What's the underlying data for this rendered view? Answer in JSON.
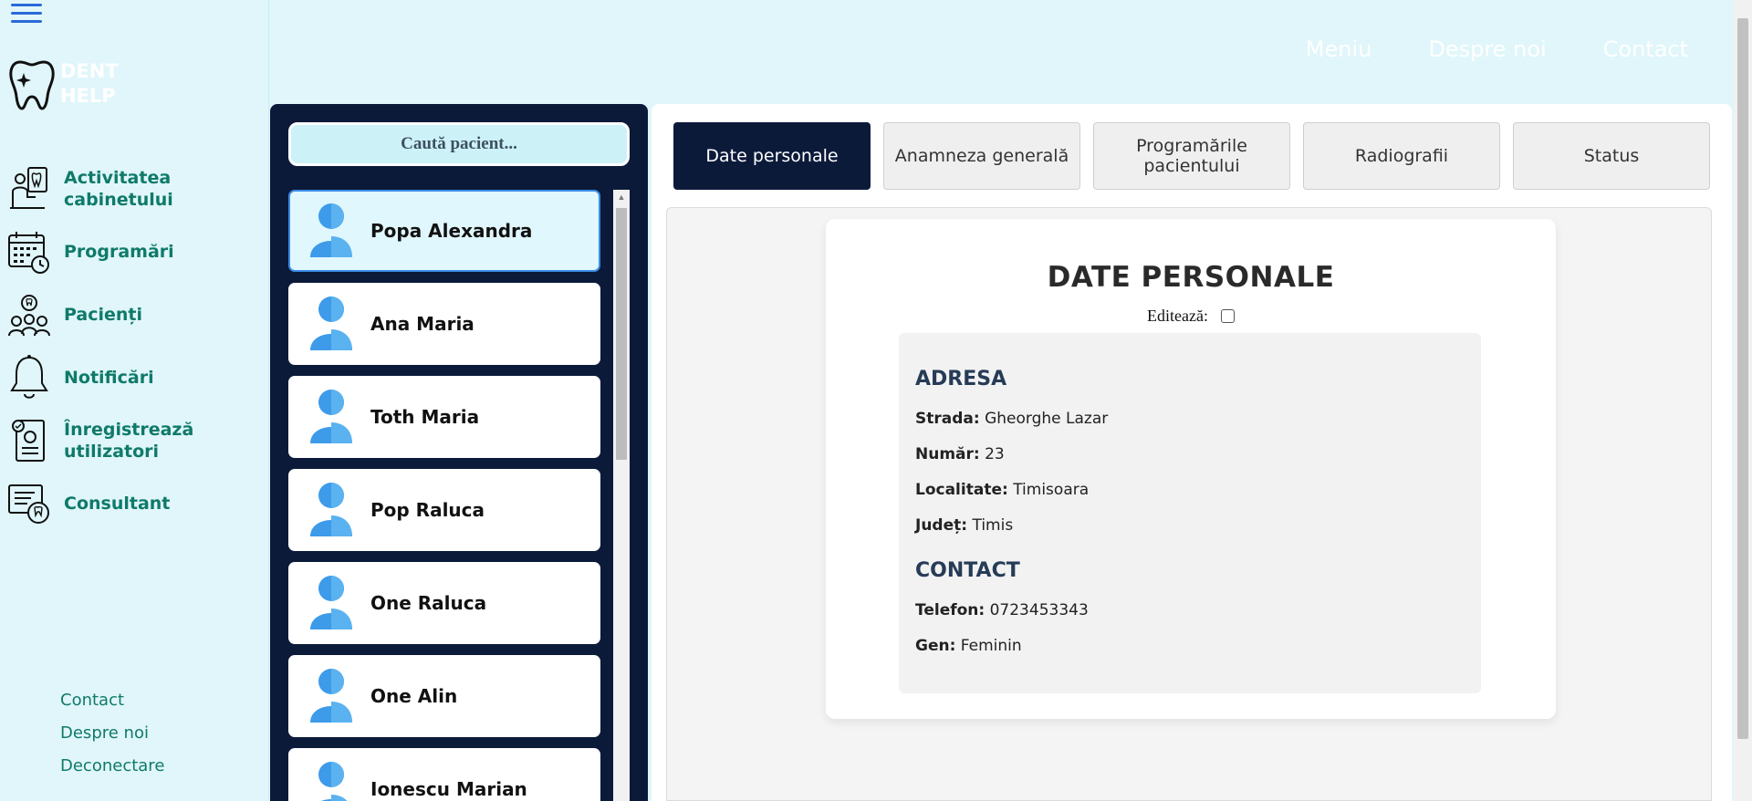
{
  "app": {
    "logo_line1": "DENT",
    "logo_line2": "HELP"
  },
  "sidebar": {
    "items": [
      {
        "label_line1": "Activitatea",
        "label_line2": "cabinetului",
        "icon": "clinic-activity-icon"
      },
      {
        "label_line1": "Programări",
        "label_line2": "",
        "icon": "calendar-icon"
      },
      {
        "label_line1": "Pacienți",
        "label_line2": "",
        "icon": "patients-icon"
      },
      {
        "label_line1": "Notificări",
        "label_line2": "",
        "icon": "bell-icon"
      },
      {
        "label_line1": "Înregistrează",
        "label_line2": "utilizatori",
        "icon": "register-users-icon"
      },
      {
        "label_line1": "Consultant",
        "label_line2": "",
        "icon": "consultant-icon"
      }
    ],
    "footer": [
      "Contact",
      "Despre noi",
      "Deconectare"
    ]
  },
  "topnav": [
    "Meniu",
    "Despre noi",
    "Contact"
  ],
  "search": {
    "label": "Caută pacient..."
  },
  "patients": [
    "Popa Alexandra",
    "Ana Maria",
    "Toth Maria",
    "Pop Raluca",
    "One Raluca",
    "One Alin",
    "Ionescu Marian"
  ],
  "tabs": [
    {
      "line1": "Date personale",
      "line2": ""
    },
    {
      "line1": "Anamneza generală",
      "line2": ""
    },
    {
      "line1": "Programările",
      "line2": "pacientului"
    },
    {
      "line1": "Radiografii",
      "line2": ""
    },
    {
      "line1": "Status",
      "line2": ""
    }
  ],
  "details": {
    "title": "DATE PERSONALE",
    "edit_label": "Editează:",
    "address_heading": "ADRESA",
    "street_label": "Strada:",
    "street": "Gheorghe Lazar",
    "number_label": "Număr:",
    "number": "23",
    "city_label": "Localitate:",
    "city": "Timisoara",
    "county_label": "Județ:",
    "county": "Timis",
    "contact_heading": "CONTACT",
    "phone_label": "Telefon:",
    "phone": "0723453343",
    "gender_label": "Gen:",
    "gender": "Feminin"
  },
  "colors": {
    "nav_text": "#0f7a6a",
    "dark_panel": "#0c1a3a",
    "background": "#e0f6fa",
    "active_card": "#e0f7fd"
  }
}
